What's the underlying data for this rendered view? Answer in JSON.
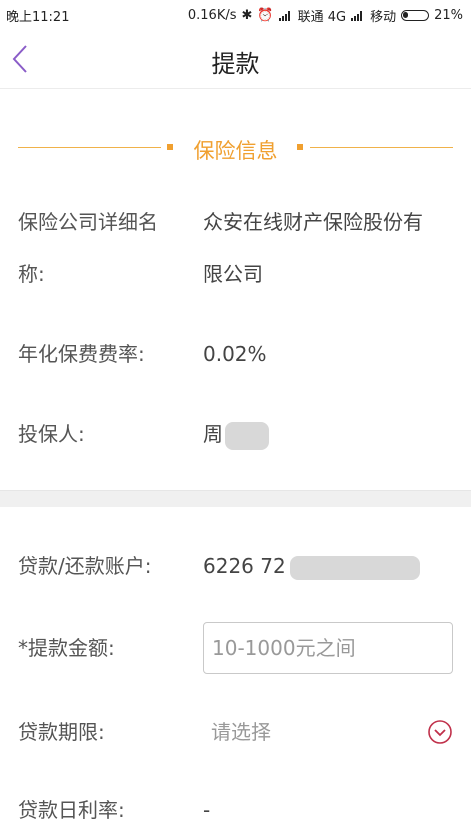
{
  "status_bar": {
    "time": "晚上11:21",
    "speed": "0.16K/s",
    "carrier1": "联通 4G",
    "carrier2": "移动",
    "battery": "21%"
  },
  "header": {
    "title": "提款"
  },
  "insurance_section": {
    "title": "保险信息",
    "company_label_line1": "保险公司详细名",
    "company_label_line2": "称:",
    "company_value_line1": "众安在线财产保险股份有",
    "company_value_line2": "限公司",
    "rate_label": "年化保费费率:",
    "rate_value": "0.02%",
    "insured_label": "投保人:",
    "insured_value": "周"
  },
  "loan_form": {
    "account_label": "贷款/还款账户:",
    "account_value": "6226 72",
    "amount_label": "*提款金额:",
    "amount_placeholder": "10-1000元之间",
    "term_label": "贷款期限:",
    "term_placeholder": "请选择",
    "daily_rate_label": "贷款日利率:",
    "daily_rate_value": "-"
  },
  "colors": {
    "accent": "#f0a030",
    "back_arrow": "#8a5cc8",
    "dropdown_icon": "#c0304a"
  }
}
